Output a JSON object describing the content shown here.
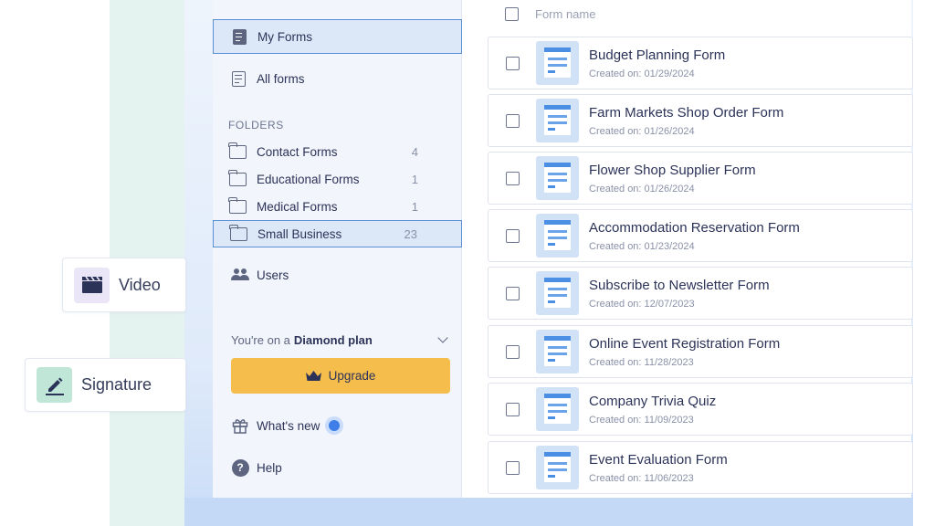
{
  "sidebar": {
    "nav": [
      {
        "label": "My Forms",
        "icon": "document-solid-icon",
        "active": true
      },
      {
        "label": "All forms",
        "icon": "document-outline-icon",
        "active": false
      }
    ],
    "folders_title": "FOLDERS",
    "folders": [
      {
        "label": "Contact Forms",
        "count": "4"
      },
      {
        "label": "Educational Forms",
        "count": "1"
      },
      {
        "label": "Medical Forms",
        "count": "1"
      },
      {
        "label": "Small Business",
        "count": "23",
        "active": true
      }
    ],
    "users_label": "Users",
    "plan": {
      "prefix": "You're on a",
      "name": "Diamond plan"
    },
    "upgrade_label": "Upgrade",
    "whats_new_label": "What's new",
    "help_label": "Help"
  },
  "table": {
    "header": "Form name",
    "rows": [
      {
        "title": "Budget Planning Form",
        "date": "Created on: 01/29/2024"
      },
      {
        "title": "Farm Markets Shop Order Form",
        "date": "Created on: 01/26/2024"
      },
      {
        "title": "Flower Shop Supplier Form",
        "date": "Created on: 01/26/2024"
      },
      {
        "title": "Accommodation Reservation Form",
        "date": "Created on: 01/23/2024"
      },
      {
        "title": "Subscribe to Newsletter Form",
        "date": "Created on: 12/07/2023"
      },
      {
        "title": "Online Event Registration Form",
        "date": "Created on: 11/28/2023"
      },
      {
        "title": "Company Trivia Quiz",
        "date": "Created on: 11/09/2023"
      },
      {
        "title": "Event Evaluation Form",
        "date": "Created on: 11/06/2023"
      }
    ]
  },
  "floating": {
    "video": {
      "label": "Video",
      "icon": "clapperboard-icon",
      "bg": "#ebe6f7"
    },
    "signature": {
      "label": "Signature",
      "icon": "pen-icon",
      "bg": "#bfe6d6"
    }
  },
  "colors": {
    "accent": "#5b8fd6",
    "upgrade": "#f5bd4c",
    "notification_dot": "#3f7ee8"
  }
}
